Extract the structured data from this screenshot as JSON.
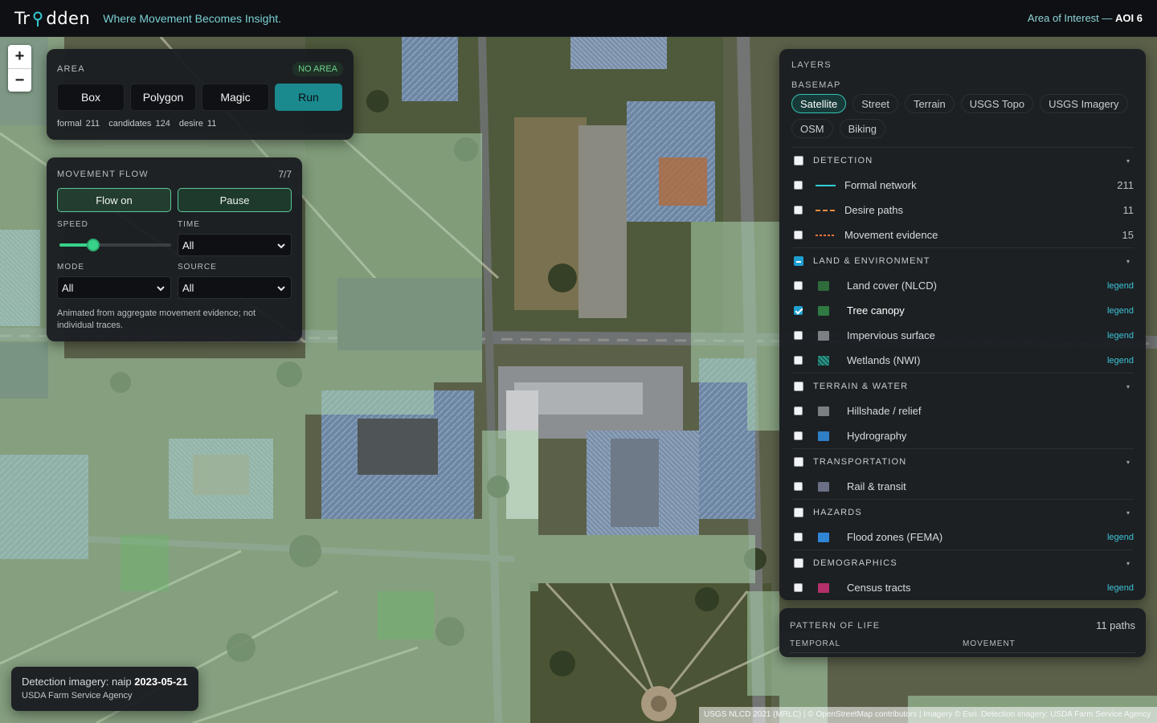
{
  "header": {
    "logo": "Trodden",
    "tagline": "Where Movement Becomes Insight.",
    "aoi_prefix": "Area of Interest —",
    "aoi_value": "AOI 6"
  },
  "zoom": {
    "in": "+",
    "out": "−"
  },
  "area": {
    "title": "AREA",
    "badge": "NO AREA",
    "buttons": [
      "Box",
      "Polygon",
      "Magic",
      "Run"
    ],
    "stats": [
      "formal 211",
      "candidates 124",
      "desire 11"
    ]
  },
  "flow": {
    "title": "MOVEMENT FLOW",
    "count": "7/7",
    "flow_on": "Flow on",
    "pause": "Pause",
    "speed_label": "SPEED",
    "speed_value": 0.3,
    "time_label": "TIME",
    "time_value": "All",
    "mode_label": "MODE",
    "mode_value": "All",
    "source_label": "SOURCE",
    "source_value": "All",
    "note": "Animated from aggregate movement evidence; not individual traces."
  },
  "layers": {
    "title": "LAYERS",
    "basemap_label": "BASEMAP",
    "basemaps": [
      "Satellite",
      "Street",
      "Terrain",
      "USGS Topo",
      "USGS Imagery",
      "OSM",
      "Biking"
    ],
    "active_basemap": "Satellite",
    "sections": [
      {
        "title": "DETECTION",
        "state": "off",
        "rows": [
          {
            "label": "Formal network",
            "count": "211",
            "color": "#2fd0d8",
            "style": "solid"
          },
          {
            "label": "Desire paths",
            "count": "11",
            "color": "#f08a3c",
            "style": "dashed"
          },
          {
            "label": "Movement evidence",
            "count": "15",
            "color": "#e8733a",
            "style": "dotted"
          }
        ]
      },
      {
        "title": "LAND & ENVIRONMENT",
        "state": "mixed",
        "rows": [
          {
            "label": "Land cover (NLCD)",
            "legend": "legend",
            "color": "#2f6b3b",
            "checked": false
          },
          {
            "label": "Tree canopy",
            "legend": "legend",
            "color": "#2e7a42",
            "checked": true
          },
          {
            "label": "Impervious surface",
            "legend": "legend",
            "color": "#7c8085",
            "checked": false
          },
          {
            "label": "Wetlands (NWI)",
            "legend": "legend",
            "color": "#2a9a8c",
            "checked": false
          }
        ]
      },
      {
        "title": "TERRAIN & WATER",
        "state": "off",
        "rows": [
          {
            "label": "Hillshade / relief",
            "color": "#7b7f84",
            "checked": false
          },
          {
            "label": "Hydrography",
            "color": "#2f7fc6",
            "checked": false
          }
        ]
      },
      {
        "title": "TRANSPORTATION",
        "state": "off",
        "rows": [
          {
            "label": "Rail & transit",
            "color": "#6a6f86",
            "checked": false
          }
        ]
      },
      {
        "title": "HAZARDS",
        "state": "off",
        "rows": [
          {
            "label": "Flood zones (FEMA)",
            "legend": "legend",
            "color": "#2f86d6",
            "checked": false
          }
        ]
      },
      {
        "title": "DEMOGRAPHICS",
        "state": "off",
        "rows": [
          {
            "label": "Census tracts",
            "legend": "legend",
            "color": "#b3306a",
            "checked": false
          }
        ]
      }
    ]
  },
  "pattern": {
    "title": "PATTERN OF LIFE",
    "paths": "11 paths",
    "temporal": "TEMPORAL",
    "movement": "MOVEMENT"
  },
  "imagery": {
    "prefix": "Detection imagery: naip",
    "date": "2023-05-21",
    "agency": "USDA Farm Service Agency"
  },
  "attribution": "USGS NLCD 2021 (MRLC) | © OpenStreetMap contributors | Imagery © Esri. Detection imagery: USDA Farm Service Agency"
}
